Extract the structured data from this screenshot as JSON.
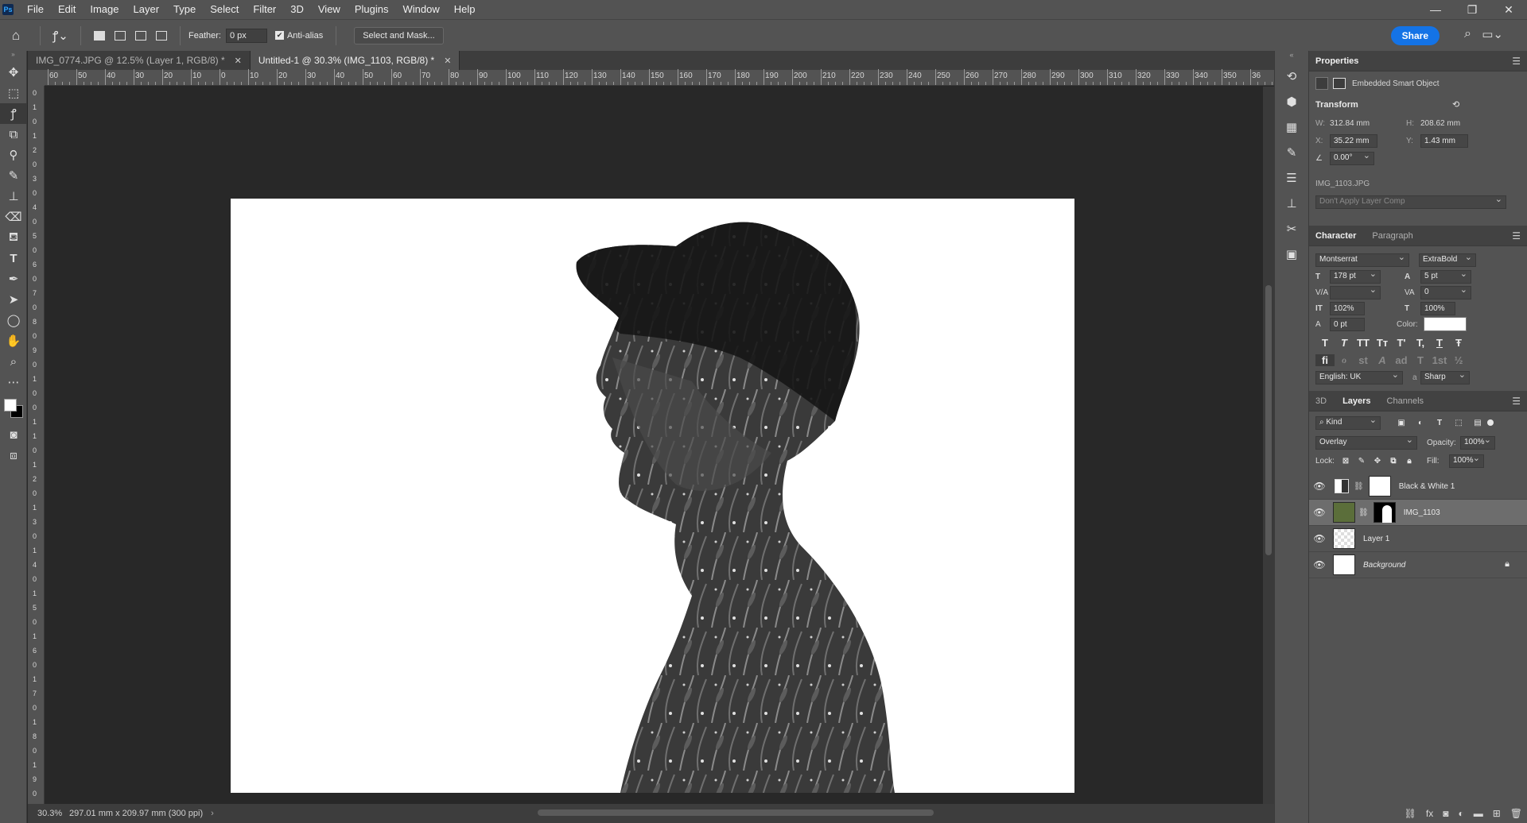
{
  "app": {
    "logo": "Ps"
  },
  "menu": [
    "File",
    "Edit",
    "Image",
    "Layer",
    "Type",
    "Select",
    "Filter",
    "3D",
    "View",
    "Plugins",
    "Window",
    "Help"
  ],
  "window_controls": {
    "minimize": "—",
    "restore": "❐",
    "close": "✕"
  },
  "options_bar": {
    "feather_label": "Feather:",
    "feather_value": "0 px",
    "antialias_label": "Anti-alias",
    "antialias_checked": true,
    "select_mask_label": "Select and Mask...",
    "share_label": "Share"
  },
  "tabs": [
    {
      "title": "IMG_0774.JPG @ 12.5% (Layer 1, RGB/8) *",
      "active": false
    },
    {
      "title": "Untitled-1 @ 30.3% (IMG_1103, RGB/8) *",
      "active": true
    }
  ],
  "ruler_top": [
    "60",
    "50",
    "40",
    "30",
    "20",
    "10",
    "0",
    "10",
    "20",
    "30",
    "40",
    "50",
    "60",
    "70",
    "80",
    "90",
    "100",
    "110",
    "120",
    "130",
    "140",
    "150",
    "160",
    "170",
    "180",
    "190",
    "200",
    "210",
    "220",
    "230",
    "240",
    "250",
    "260",
    "270",
    "280",
    "290",
    "300",
    "310",
    "320",
    "330",
    "340",
    "350",
    "36"
  ],
  "ruler_left": [
    "0",
    "1",
    "0",
    "1",
    "2",
    "0",
    "3",
    "0",
    "4",
    "0",
    "5",
    "0",
    "6",
    "0",
    "7",
    "0",
    "8",
    "0",
    "9",
    "0",
    "1",
    "0",
    "0",
    "1",
    "1",
    "0",
    "1",
    "2",
    "0",
    "1",
    "3",
    "0",
    "1",
    "4",
    "0",
    "1",
    "5",
    "0",
    "1",
    "6",
    "0",
    "1",
    "7",
    "0",
    "1",
    "8",
    "0",
    "1",
    "9",
    "0"
  ],
  "status": {
    "zoom": "30.3%",
    "doc_size": "297.01 mm x 209.97 mm (300 ppi)"
  },
  "properties": {
    "title": "Properties",
    "object_type": "Embedded Smart Object",
    "transform_label": "Transform",
    "w_label": "W:",
    "w_value": "312.84 mm",
    "h_label": "H:",
    "h_value": "208.62 mm",
    "x_label": "X:",
    "x_value": "35.22 mm",
    "y_label": "Y:",
    "y_value": "1.43 mm",
    "angle_value": "0.00°",
    "source_file": "IMG_1103.JPG",
    "layer_comp": "Don't Apply Layer Comp"
  },
  "character": {
    "tab_character": "Character",
    "tab_paragraph": "Paragraph",
    "font_family": "Montserrat",
    "font_style": "ExtraBold",
    "font_size": "178 pt",
    "leading": "5 pt",
    "kerning": "",
    "tracking": "0",
    "vscale": "102%",
    "hscale": "100%",
    "baseline": "0 pt",
    "color_label": "Color:",
    "color_value": "#ffffff",
    "language": "English: UK",
    "antialias": "Sharp",
    "style_buttons": [
      "T",
      "T",
      "TT",
      "Tт",
      "T'",
      "T,",
      "T",
      "Ŧ"
    ],
    "opentype_buttons": [
      "fi",
      "ℴ",
      "st",
      "A",
      "ad",
      "T",
      "1st",
      "½"
    ]
  },
  "layers_panel": {
    "tab_3d": "3D",
    "tab_layers": "Layers",
    "tab_channels": "Channels",
    "filter_kind": "Kind",
    "blend_mode": "Overlay",
    "opacity_label": "Opacity:",
    "opacity_value": "100%",
    "lock_label": "Lock:",
    "fill_label": "Fill:",
    "fill_value": "100%",
    "layers": [
      {
        "name": "Black & White 1",
        "selected": false,
        "italic": false
      },
      {
        "name": "IMG_1103",
        "selected": true,
        "italic": false
      },
      {
        "name": "Layer 1",
        "selected": false,
        "italic": false
      },
      {
        "name": "Background",
        "selected": false,
        "italic": true,
        "locked": true
      }
    ]
  }
}
